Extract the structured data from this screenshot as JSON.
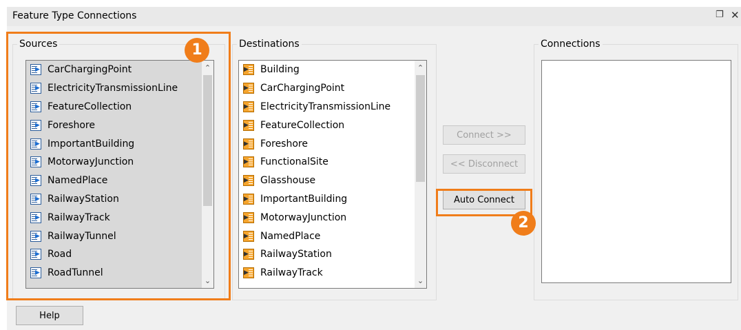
{
  "window": {
    "title": "Feature Type Connections",
    "restore_glyph": "❐",
    "close_glyph": "✕"
  },
  "sources": {
    "label": "Sources",
    "items": [
      "CarChargingPoint",
      "ElectricityTransmissionLine",
      "FeatureCollection",
      "Foreshore",
      "ImportantBuilding",
      "MotorwayJunction",
      "NamedPlace",
      "RailwayStation",
      "RailwayTrack",
      "RailwayTunnel",
      "Road",
      "RoadTunnel"
    ],
    "icon": "feature-type-source-icon"
  },
  "destinations": {
    "label": "Destinations",
    "items": [
      "Building",
      "CarChargingPoint",
      "ElectricityTransmissionLine",
      "FeatureCollection",
      "Foreshore",
      "FunctionalSite",
      "Glasshouse",
      "ImportantBuilding",
      "MotorwayJunction",
      "NamedPlace",
      "RailwayStation",
      "RailwayTrack"
    ],
    "icon": "feature-type-destination-icon"
  },
  "connections": {
    "label": "Connections"
  },
  "buttons": {
    "connect": "Connect >>",
    "disconnect": "<< Disconnect",
    "auto_connect": "Auto Connect",
    "help": "Help"
  },
  "callouts": {
    "badge1": "1",
    "badge2": "2",
    "color": "#f07d1a"
  }
}
